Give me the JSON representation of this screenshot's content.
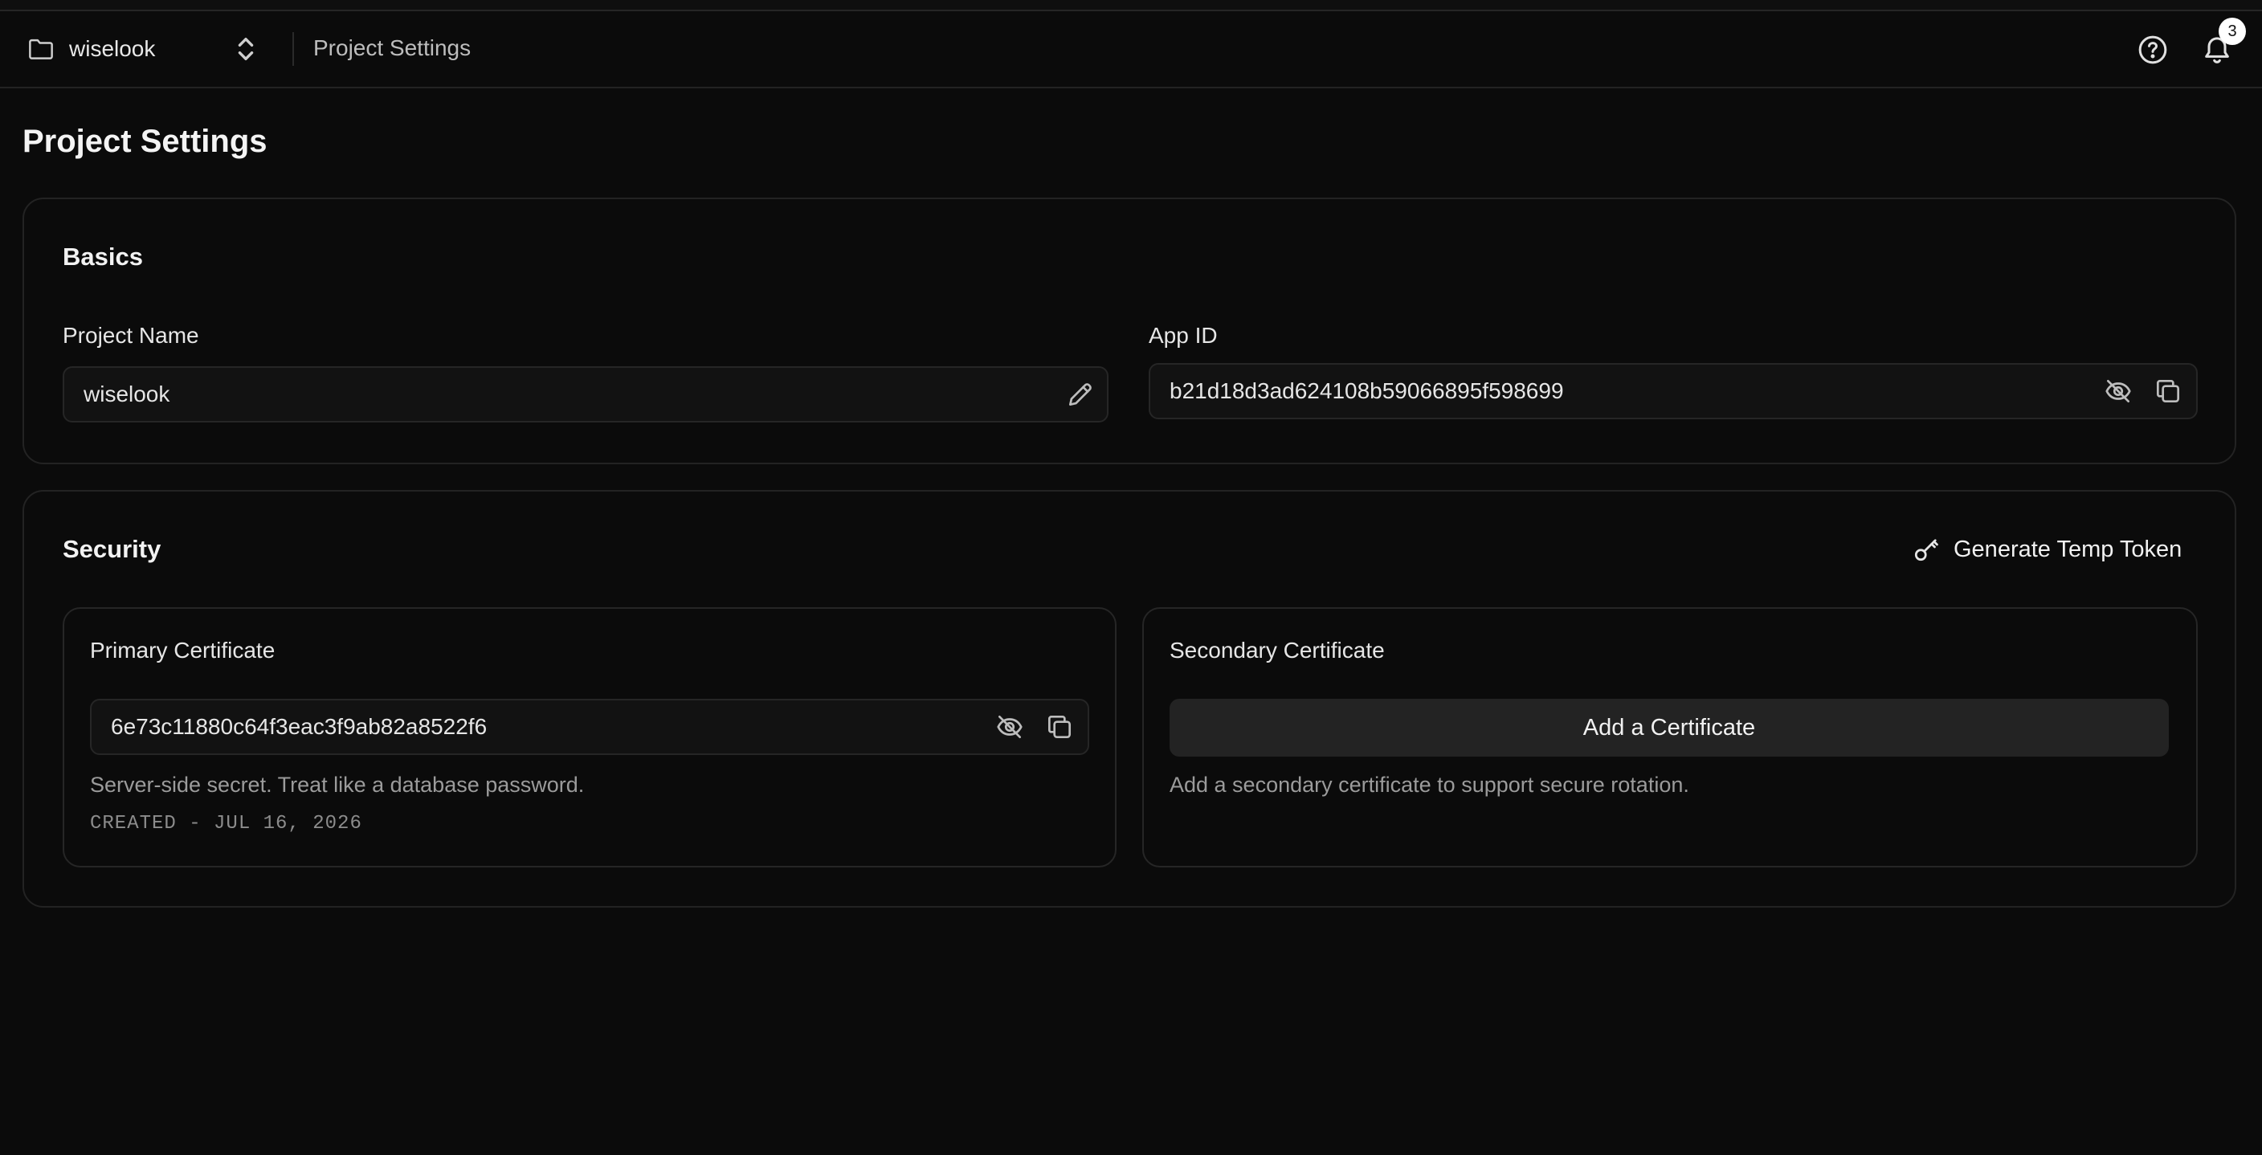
{
  "header": {
    "project_name": "wiselook",
    "breadcrumb": "Project Settings",
    "notifications_count": "3"
  },
  "page": {
    "title": "Project Settings"
  },
  "basics": {
    "title": "Basics",
    "project_name_label": "Project Name",
    "project_name_value": "wiselook",
    "app_id_label": "App ID",
    "app_id_value": "b21d18d3ad624108b59066895f598699"
  },
  "security": {
    "title": "Security",
    "generate_token_label": "Generate Temp Token",
    "primary": {
      "title": "Primary Certificate",
      "value": "6e73c11880c64f3eac3f9ab82a8522f6",
      "helper": "Server-side secret. Treat like a database password.",
      "created": "CREATED - JUL 16, 2026"
    },
    "secondary": {
      "title": "Secondary Certificate",
      "add_label": "Add a Certificate",
      "helper": "Add a secondary certificate to support secure rotation."
    }
  },
  "icons": {
    "folder": "folder-icon",
    "chevrons": "chevron-up-down-icon",
    "help": "help-circle-icon",
    "bell": "bell-icon",
    "pencil": "pencil-icon",
    "eye_off": "eye-off-icon",
    "copy": "copy-icon",
    "key": "key-icon"
  },
  "colors": {
    "background": "#0b0b0b",
    "border": "#232323",
    "button_bg": "#232323",
    "text": "#ededed",
    "muted": "#9b9b9b"
  }
}
